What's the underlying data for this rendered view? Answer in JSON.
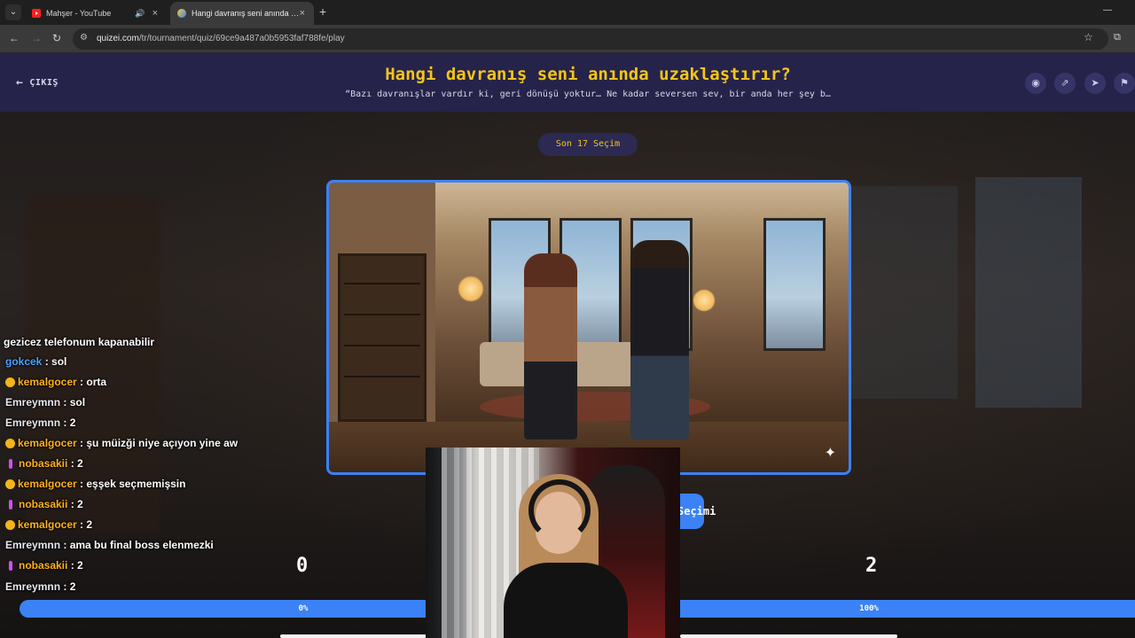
{
  "browser": {
    "tabs": [
      {
        "title": "Mahşer - YouTube",
        "favicon": "youtube-icon",
        "audio": true,
        "active": false
      },
      {
        "title": "Hangi davranış seni anında uzaklaştırır",
        "favicon": "quizei-icon",
        "audio": false,
        "active": true
      }
    ],
    "url_host": "quizei.com",
    "url_path": "/tr/tournament/quiz/69ce9a487a0b5953faf788fe/play"
  },
  "header": {
    "exit_label": "ÇIKIŞ",
    "title": "Hangi davranış seni anında uzaklaştırır?",
    "subtitle": "“Bazı davranışlar vardır ki, geri dönüşü yoktur… Ne kadar seversen sev, bir anda her şey b…",
    "icons": [
      "eye-icon",
      "share-icon",
      "send-icon",
      "flag-icon"
    ]
  },
  "round_label": "Son 17 Seçim",
  "choose_label": "Seçimi",
  "scores": {
    "left": "0",
    "right": "2"
  },
  "bars": {
    "left_label": "0%",
    "right_label": "100%",
    "left_value": 0,
    "right_value": 100
  },
  "chat": {
    "header": "gezicez telefonum kapanabilir",
    "messages": [
      {
        "user": "gokcek",
        "text": "sol",
        "color": "blue",
        "badge": "none"
      },
      {
        "user": "kemalgocer",
        "text": "orta",
        "color": "orange",
        "badge": "gold"
      },
      {
        "user": "Emreymnn",
        "text": "sol",
        "color": "white",
        "badge": "none"
      },
      {
        "user": "Emreymnn",
        "text": "2",
        "color": "white",
        "badge": "none"
      },
      {
        "user": "kemalgocer",
        "text": "şu müizği niye açıyon yine aw",
        "color": "orange",
        "badge": "gold"
      },
      {
        "user": "nobasakii",
        "text": "2",
        "color": "orange",
        "badge": "pink"
      },
      {
        "user": "kemalgocer",
        "text": "eşşek seçmemişsin",
        "color": "orange",
        "badge": "gold"
      },
      {
        "user": "nobasakii",
        "text": "2",
        "color": "orange",
        "badge": "pink"
      },
      {
        "user": "kemalgocer",
        "text": "2",
        "color": "orange",
        "badge": "gold"
      },
      {
        "user": "Emreymnn",
        "text": "ama bu final boss elenmezki",
        "color": "white",
        "badge": "none"
      },
      {
        "user": "nobasakii",
        "text": "2",
        "color": "orange",
        "badge": "pink"
      },
      {
        "user": "Emreymnn",
        "text": "2",
        "color": "white",
        "badge": "none"
      }
    ]
  },
  "colors": {
    "accent": "#3b82f6",
    "title": "#f5c518",
    "header_bg": "#25234a"
  }
}
